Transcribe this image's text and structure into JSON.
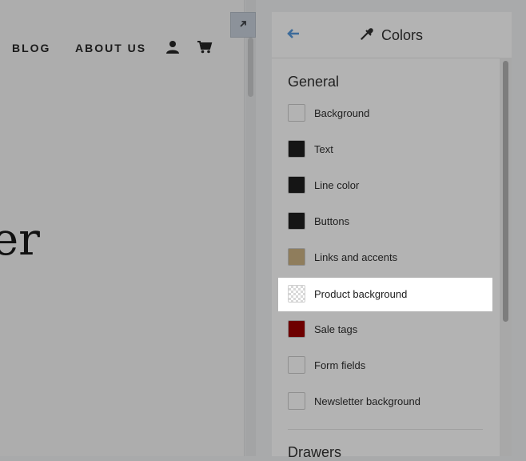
{
  "store_nav": {
    "links": [
      "BLOG",
      "ABOUT US"
    ],
    "account_icon": "user-icon",
    "cart_icon": "cart-icon"
  },
  "hero": {
    "partial_text": "er"
  },
  "preview": {
    "expand_icon": "expand-arrow-icon"
  },
  "panel": {
    "back_icon": "back-arrow-icon",
    "title_icon": "eyedropper-icon",
    "title": "Colors",
    "sections": [
      {
        "title": "General",
        "items": [
          {
            "label": "Background",
            "color": "#b3b3b3"
          },
          {
            "label": "Text",
            "color": "#151515"
          },
          {
            "label": "Line color",
            "color": "#151515"
          },
          {
            "label": "Buttons",
            "color": "#151515"
          },
          {
            "label": "Links and accents",
            "color": "#8f7d5c"
          },
          {
            "label": "Product background",
            "color": "transparent",
            "selected": true
          },
          {
            "label": "Sale tags",
            "color": "#6e0000"
          },
          {
            "label": "Form fields",
            "color": "#b3b3b3"
          },
          {
            "label": "Newsletter background",
            "color": "#b3b3b3"
          }
        ]
      },
      {
        "title": "Drawers",
        "items": []
      }
    ]
  }
}
